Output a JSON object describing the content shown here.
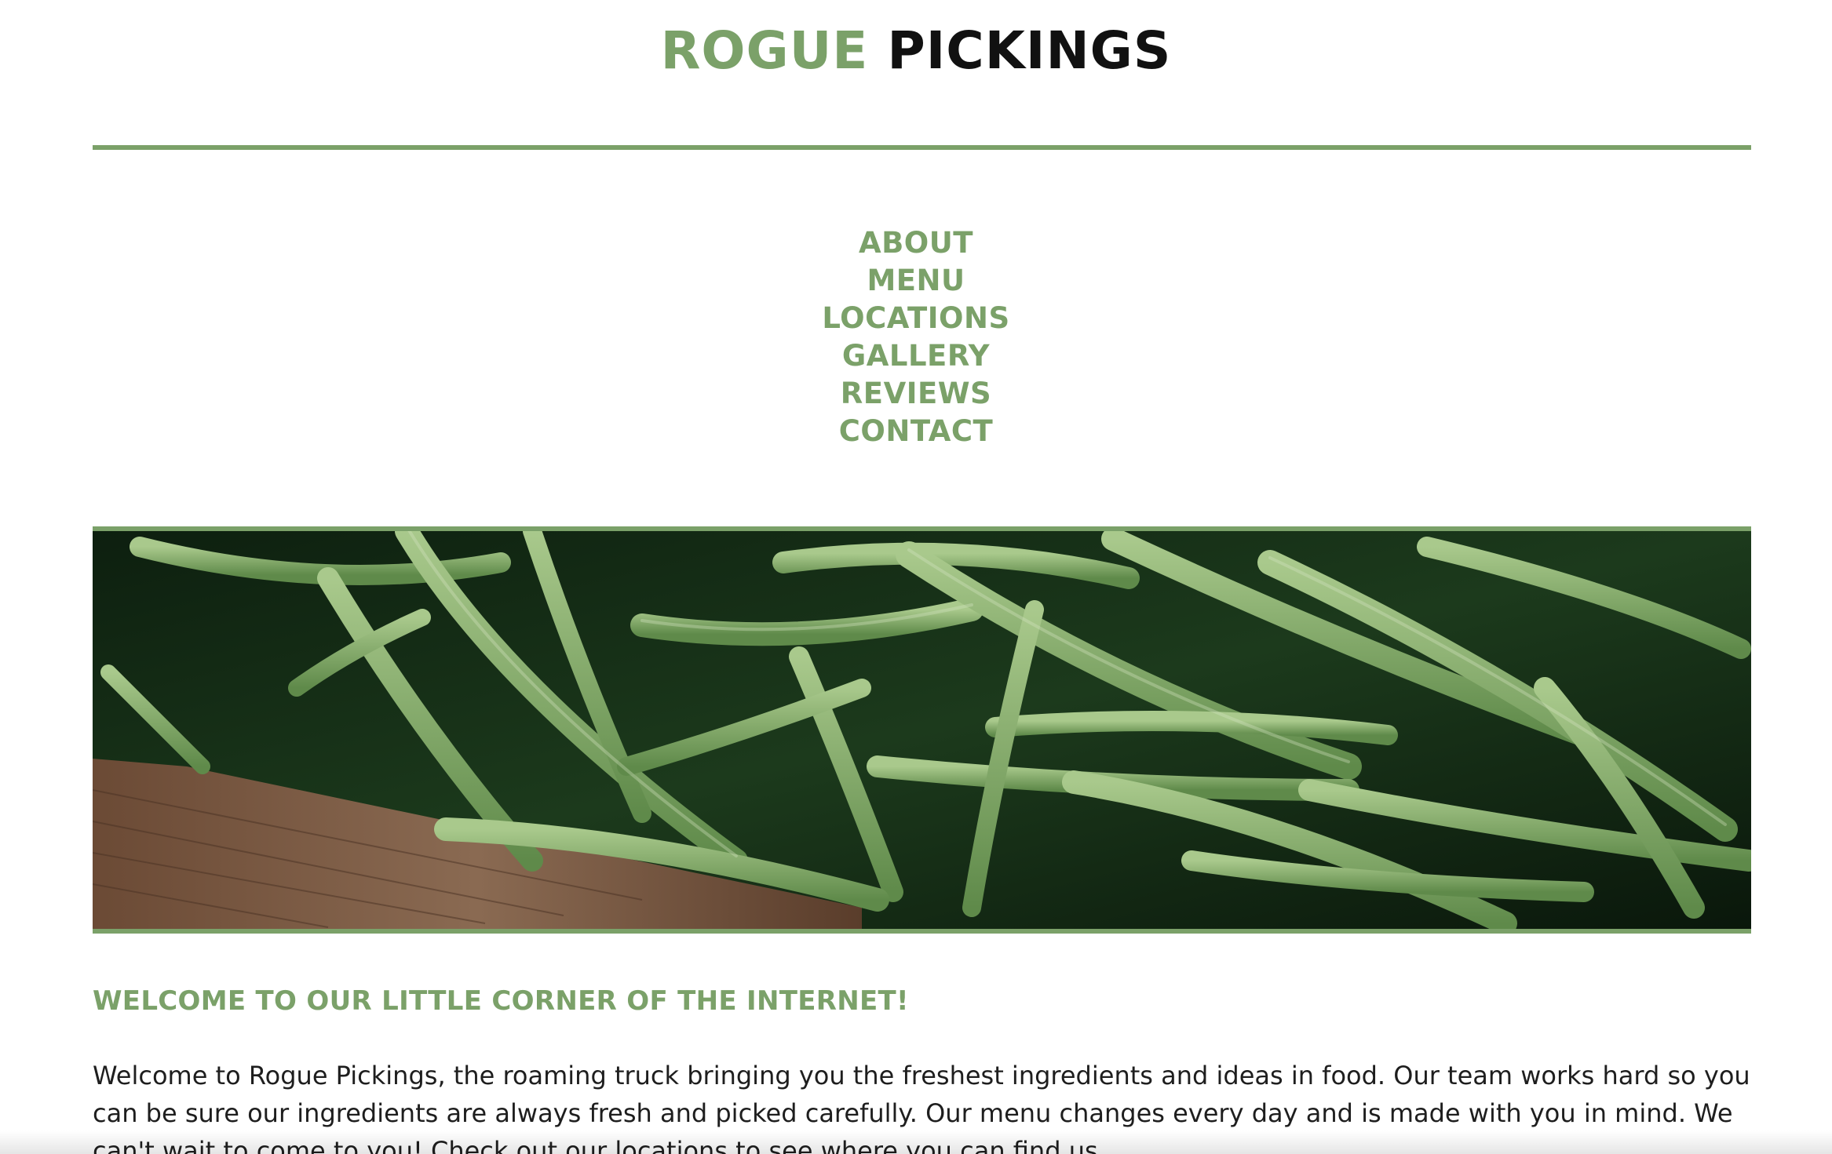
{
  "header": {
    "brand_first": "ROGUE",
    "brand_second": "PICKINGS"
  },
  "nav": {
    "items": [
      "ABOUT",
      "MENU",
      "LOCATIONS",
      "GALLERY",
      "REVIEWS",
      "CONTACT"
    ]
  },
  "hero": {
    "image": "green-beans-photo"
  },
  "welcome": {
    "heading": "WELCOME TO OUR LITTLE CORNER OF THE INTERNET!",
    "body": "Welcome to Rogue Pickings, the roaming truck bringing you the freshest ingredients and ideas in food. Our team works hard so you can be sure our ingredients are always fresh and picked carefully. Our menu changes every day and is made with you in mind. We can't wait to come to you! Check out our locations to see where you can find us."
  },
  "colors": {
    "accent": "#7ba169",
    "text": "#1e1e1e",
    "brand_dark": "#111111"
  }
}
